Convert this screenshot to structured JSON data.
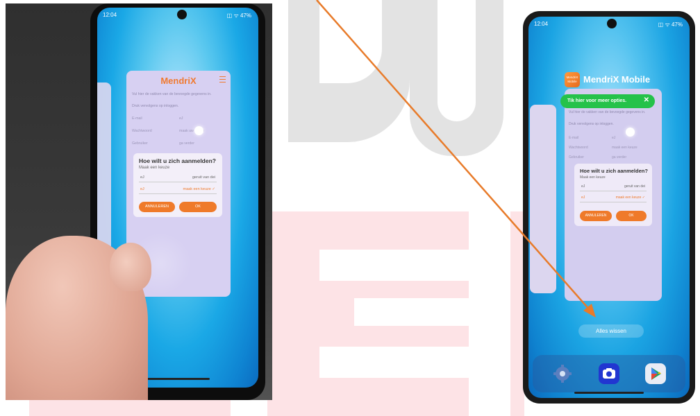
{
  "colors": {
    "accent": "#ef7a2a",
    "arrow": "#e87b2a",
    "tip_green": "#25c24a"
  },
  "left_phone": {
    "status_time": "12:04",
    "status_icons": "◫ ᯤ 47%",
    "app_title": "MendriX",
    "body_line1": "Vul hier de vakken van de bevoegde gegevens in.",
    "body_line2": "Druk vervolgens op inloggen.",
    "field_labels": [
      "E-mail",
      "Wachtwoord",
      "Gebruiker"
    ],
    "field_values": [
      "eJ",
      "maak uw keuze",
      "ga verder"
    ],
    "dialog_title": "Hoe wilt u zich aanmelden?",
    "dialog_subtitle": "Maak een keuze",
    "option1_left": "eJ",
    "option1_right": "geruit van dei",
    "option2_left": "eJ",
    "option2_right": "maak een keuze ✓",
    "cancel_label": "ANNULEREN",
    "ok_label": "OK"
  },
  "right_phone": {
    "status_time": "12:04",
    "status_icons": "◫ ᯤ 47%",
    "app_name": "MendriX Mobile",
    "app_icon_text": "MendriX Mobile",
    "tooltip_text": "Tik hier voor meer opties.",
    "tooltip_close": "✕",
    "body_line1": "Vul hier de vakken van de bevoegde gegevens in.",
    "body_line2": "Druk vervolgens op inloggen.",
    "field_labels": [
      "E-mail",
      "Wachtwoord",
      "Gebruiker"
    ],
    "field_values": [
      "eJ",
      "maak een keuze",
      "ga verder"
    ],
    "dialog_title": "Hoe wilt u zich aanmelden?",
    "dialog_subtitle": "Maak een keuze",
    "option1_left": "eJ",
    "option1_right": "geruit van dei",
    "option2_left": "eJ",
    "option2_right": "maak een keuze ✓",
    "cancel_label": "ANNULEREN",
    "ok_label": "OK",
    "clear_all_label": "Alles wissen",
    "dock_icons": [
      "settings-icon",
      "camera-icon",
      "play-store-icon"
    ]
  }
}
